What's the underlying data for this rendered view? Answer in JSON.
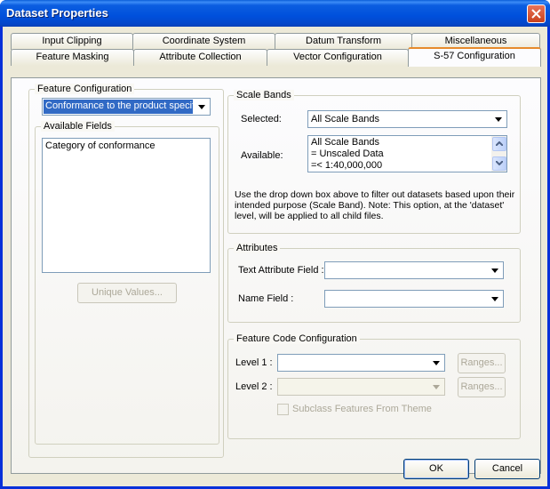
{
  "window": {
    "title": "Dataset Properties"
  },
  "tabs": {
    "row1": [
      "Input Clipping",
      "Coordinate System",
      "Datum Transform",
      "Miscellaneous"
    ],
    "row2": [
      "Feature Masking",
      "Attribute Collection",
      "Vector Configuration",
      "S-57 Configuration"
    ],
    "active": "S-57 Configuration"
  },
  "feature_configuration": {
    "group_label": "Feature Configuration",
    "selected_value": "Conformance to the product specific",
    "available_fields": {
      "group_label": "Available Fields",
      "items": [
        "Category of conformance"
      ]
    },
    "unique_values_button": "Unique Values..."
  },
  "scale_bands": {
    "group_label": "Scale Bands",
    "selected_label": "Selected:",
    "selected_value": "All Scale Bands",
    "available_label": "Available:",
    "available_items": [
      "All Scale Bands",
      "= Unscaled Data",
      "=< 1:40,000,000"
    ],
    "hint": "Use the drop down box above to filter out datasets based upon their intended purpose (Scale Band). Note: This option, at the 'dataset' level, will be applied to all child files."
  },
  "attributes": {
    "group_label": "Attributes",
    "text_attribute_label": "Text Attribute Field :",
    "text_attribute_value": "",
    "name_field_label": "Name Field :",
    "name_field_value": ""
  },
  "feature_code_configuration": {
    "group_label": "Feature Code Configuration",
    "level1_label": "Level 1 :",
    "level1_value": "",
    "level2_label": "Level 2 :",
    "level2_value": "",
    "ranges_label": "Ranges...",
    "subclass_label": "Subclass Features From Theme",
    "subclass_checked": false
  },
  "footer": {
    "ok": "OK",
    "cancel": "Cancel"
  }
}
